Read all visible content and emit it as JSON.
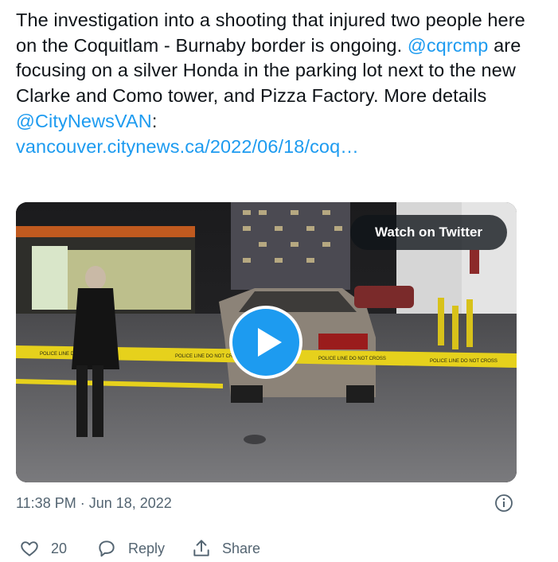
{
  "tweet": {
    "text_intro": "The investigation into a shooting that injured two people here on the Coquitlam - Burnaby border is ongoing. ",
    "mention_1": "@cqrcmp",
    "text_middle": " are focusing on a silver Honda in the parking lot next to the new Clarke and Como tower, and Pizza Factory. More details ",
    "mention_2": "@CityNewsVAN",
    "text_colon": ":",
    "link": "vancouver.citynews.ca/2022/06/18/coq…"
  },
  "media": {
    "watch_label": "Watch on Twitter",
    "play_icon": "play-icon",
    "tape_text": "POLICE LINE  DO NOT CROSS"
  },
  "meta": {
    "timestamp": "11:38 PM · Jun 18, 2022",
    "info_icon": "info-icon"
  },
  "actions": {
    "like_count": "20",
    "reply_label": "Reply",
    "share_label": "Share"
  },
  "colors": {
    "link": "#1d9bf0",
    "secondary": "#536471",
    "play": "#1d9bf0"
  }
}
